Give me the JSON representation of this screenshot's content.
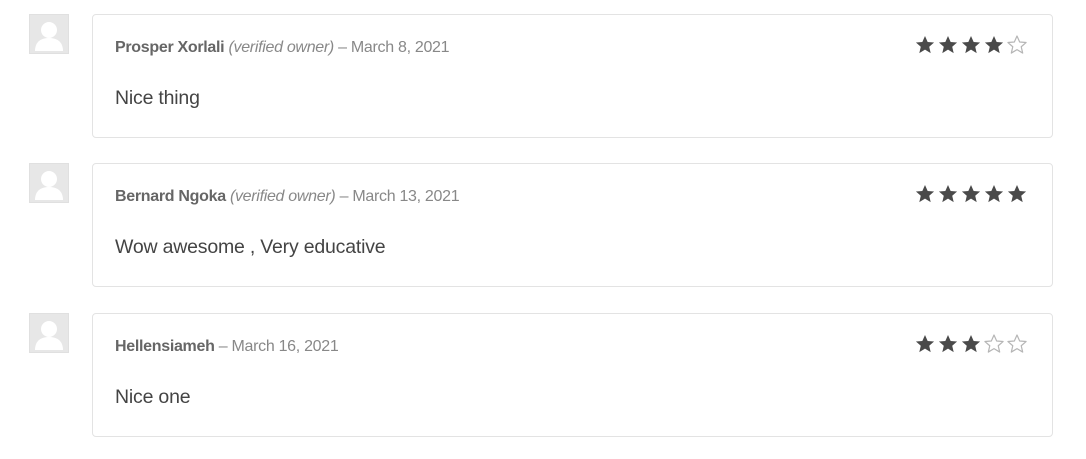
{
  "reviews": [
    {
      "author": "Prosper Xorlali",
      "verified": "(verified owner)",
      "separator": "–",
      "date": "March 8, 2021",
      "text": "Nice thing",
      "rating": 4,
      "rating_max": 5
    },
    {
      "author": "Bernard Ngoka",
      "verified": "(verified owner)",
      "separator": "–",
      "date": "March 13, 2021",
      "text": "Wow awesome , Very educative",
      "rating": 5,
      "rating_max": 5
    },
    {
      "author": "Hellensiameh",
      "verified": "",
      "separator": "–",
      "date": "March 16, 2021",
      "text": "Nice one",
      "rating": 3,
      "rating_max": 5
    }
  ],
  "colors": {
    "star_filled": "#4a4a4a",
    "star_empty": "#b5b5b5",
    "avatar_bg": "#e7e7e7",
    "avatar_figure": "#ffffff"
  },
  "icons": {
    "avatar": "default-avatar-icon",
    "star_filled": "star-filled-icon",
    "star_empty": "star-empty-icon"
  }
}
